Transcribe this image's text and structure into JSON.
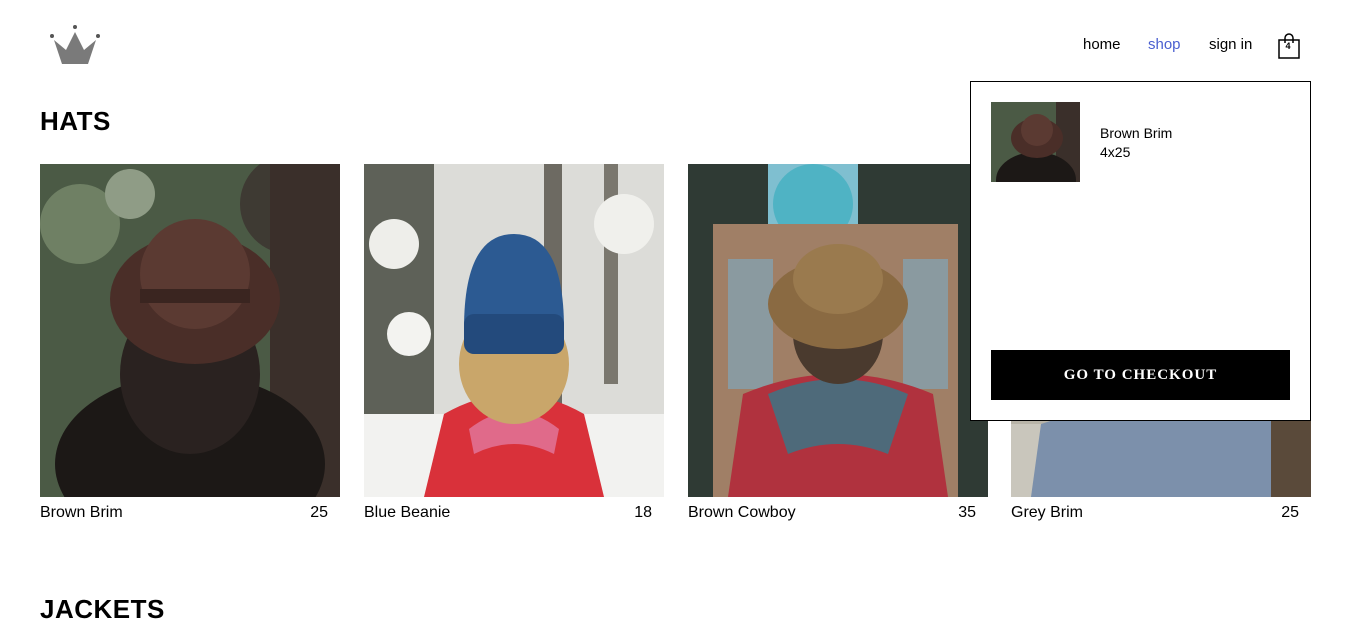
{
  "nav": {
    "home_label": "home",
    "shop_label": "shop",
    "signin_label": "sign in",
    "cart_count": "4",
    "active_color": "#4a5fd0"
  },
  "sections": [
    {
      "title": "HATS",
      "items": [
        {
          "name": "Brown Brim",
          "price": "25"
        },
        {
          "name": "Blue Beanie",
          "price": "18"
        },
        {
          "name": "Brown Cowboy",
          "price": "35"
        },
        {
          "name": "Grey Brim",
          "price": "25"
        }
      ]
    },
    {
      "title": "JACKETS"
    }
  ],
  "cart_dropdown": {
    "items": [
      {
        "name": "Brown Brim",
        "quantity_price": "4x25"
      }
    ],
    "checkout_label": "GO TO CHECKOUT"
  },
  "icons": [
    "crown-logo-icon",
    "shopping-bag-icon"
  ]
}
